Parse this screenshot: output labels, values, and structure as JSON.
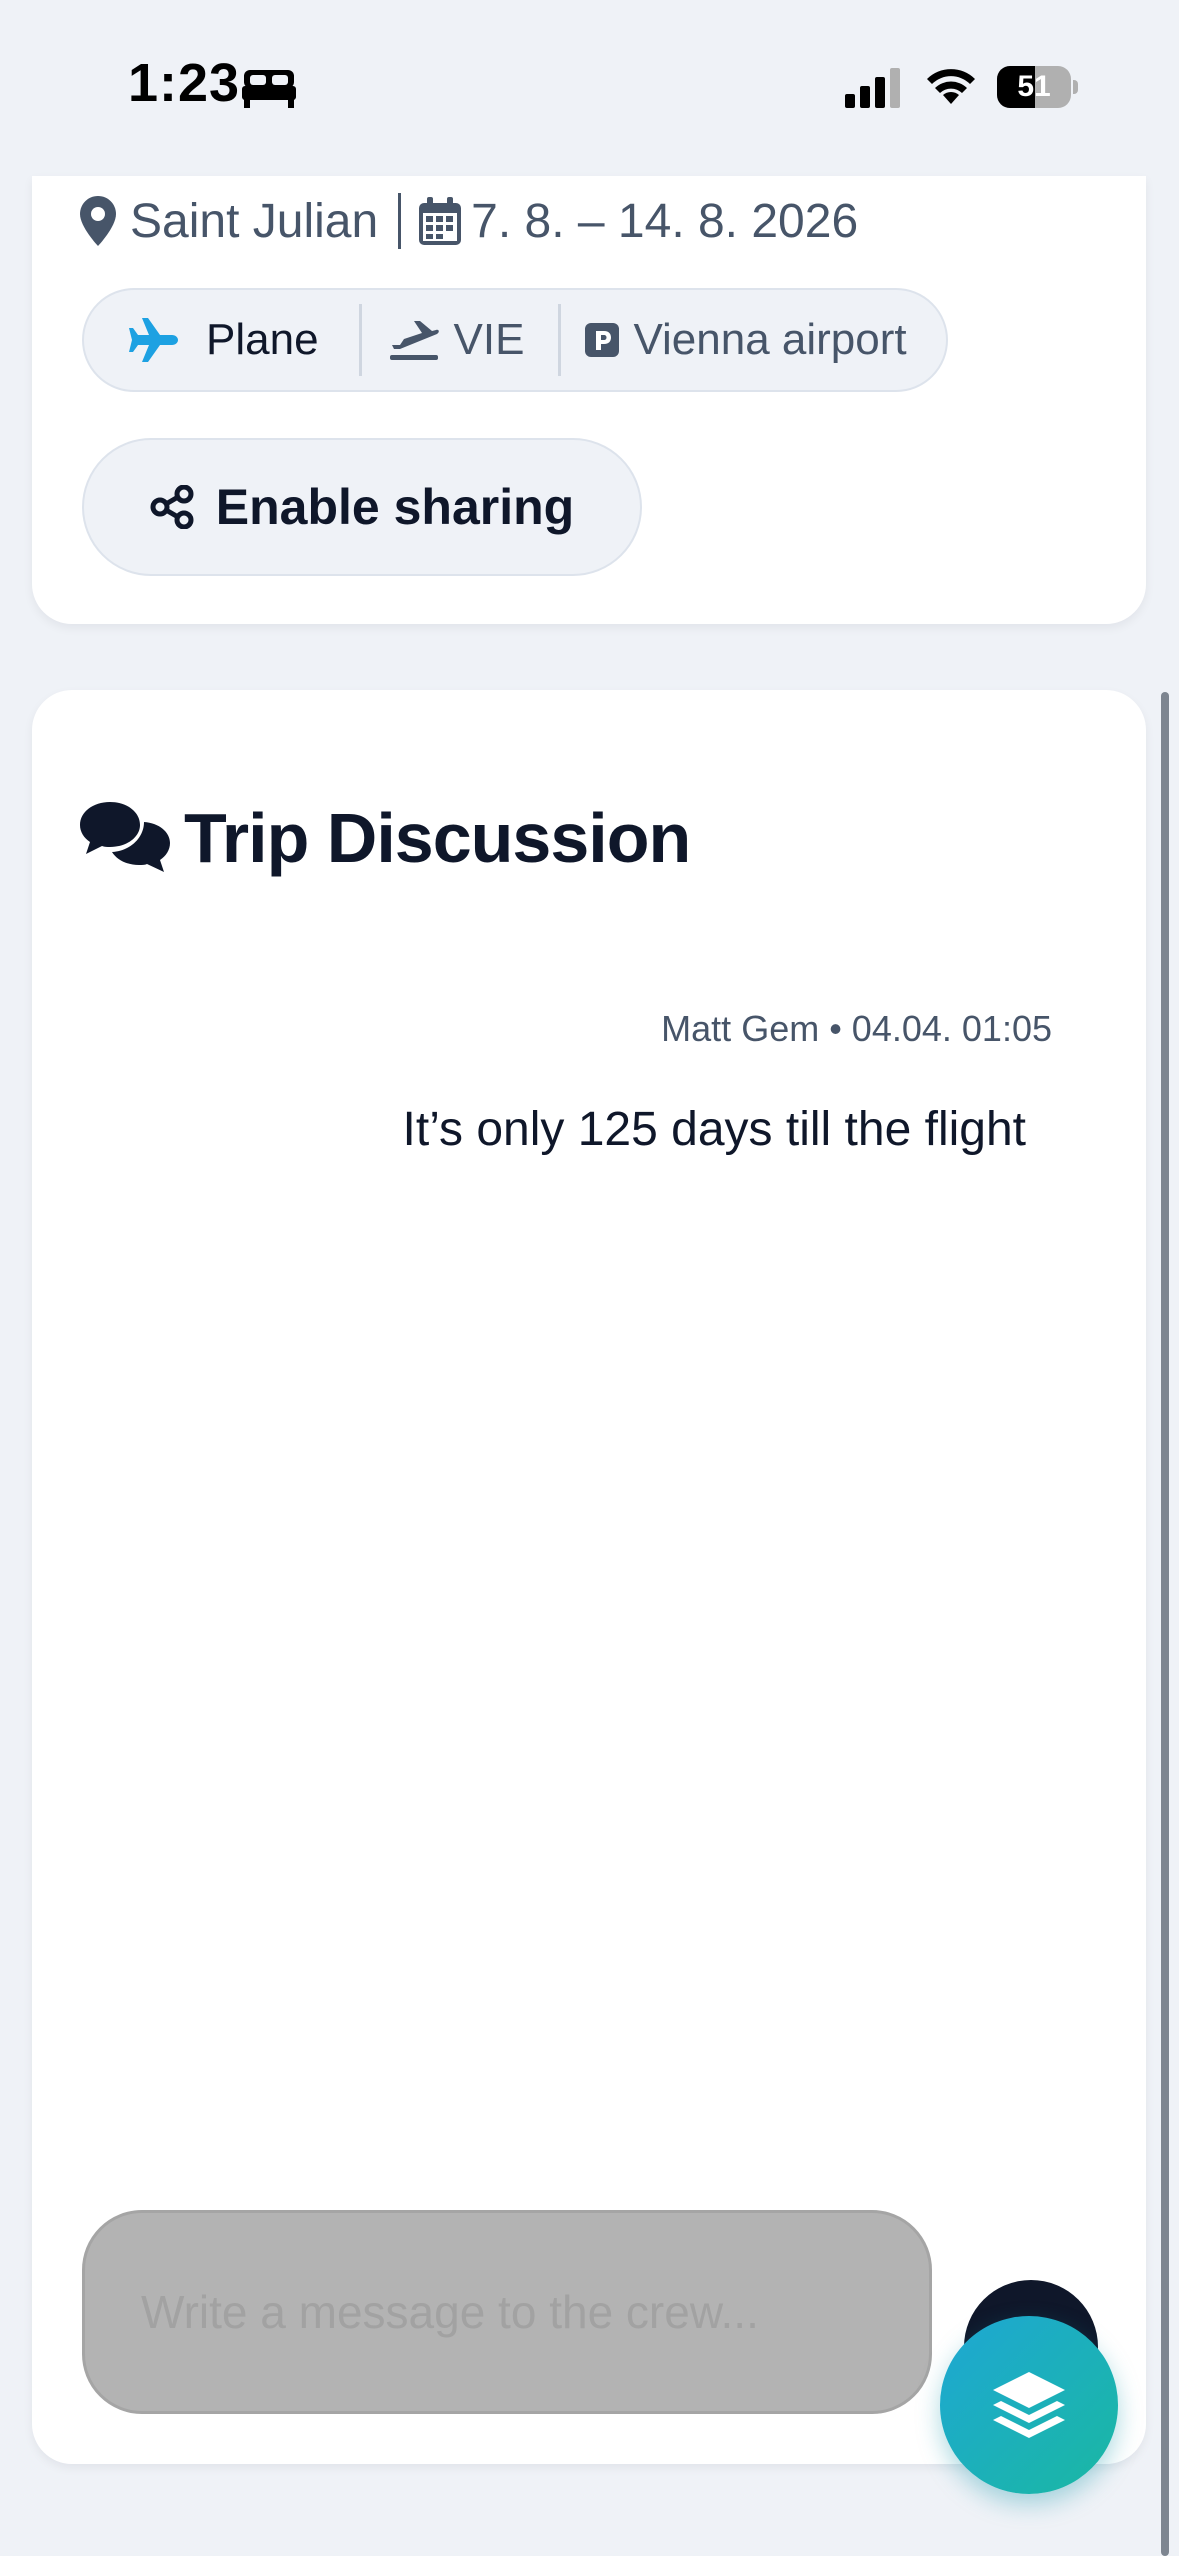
{
  "status_bar": {
    "time": "1:23",
    "battery_level": "51",
    "battery_fraction": 0.51,
    "icons": [
      "bed-icon",
      "cellular-signal-icon",
      "wifi-icon",
      "battery-icon"
    ]
  },
  "trip": {
    "location": "Saint Julian",
    "dates": "7. 8. – 14. 8. 2026",
    "transport": {
      "mode": "Plane",
      "airport_code": "VIE",
      "parking": "Vienna airport"
    },
    "share_label": "Enable sharing"
  },
  "discussion": {
    "title": "Trip Discussion",
    "messages": [
      {
        "author": "Matt Gem",
        "timestamp": "04.04. 01:05",
        "meta": "Matt Gem • 04.04. 01:05",
        "text": "It’s only 125 days till the flight"
      }
    ],
    "input_placeholder": "Write a message to the crew..."
  },
  "colors": {
    "background": "#eff2f7",
    "text_primary": "#0f172a",
    "text_secondary": "#475569",
    "plane_accent": "#1da1e2",
    "fab_gradient_start": "#1ea7d4",
    "fab_gradient_end": "#1ab8a2"
  }
}
